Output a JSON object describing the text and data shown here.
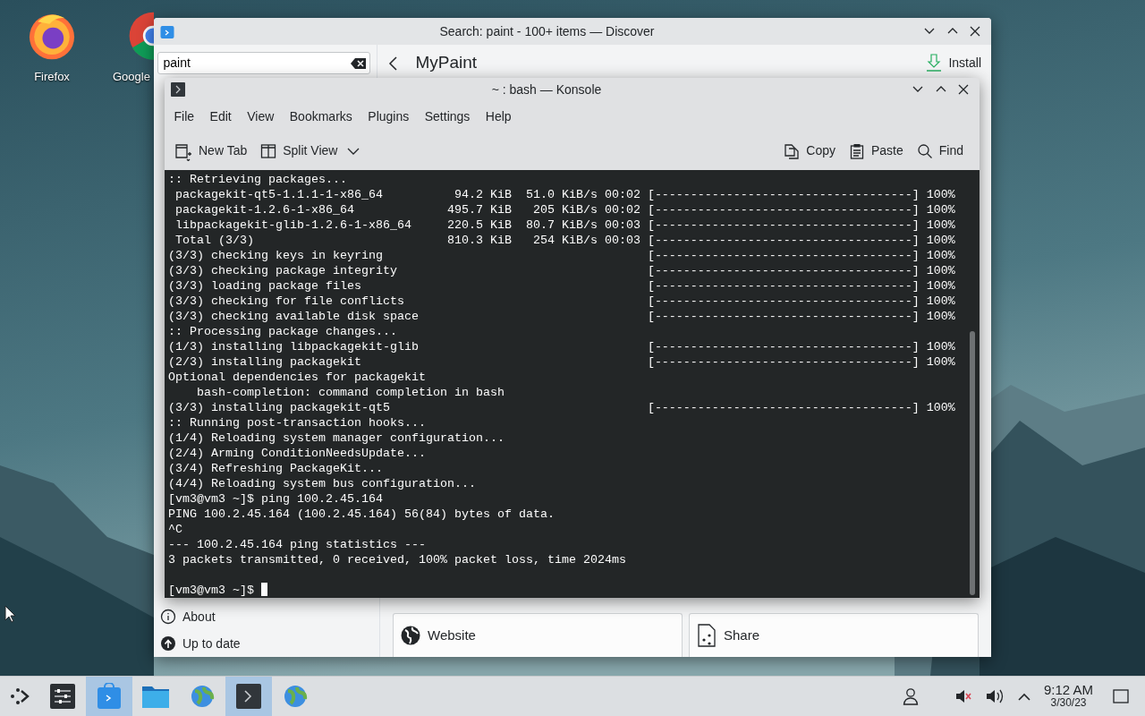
{
  "desktop": {
    "icons": [
      {
        "kind": "firefox",
        "label": "Firefox"
      },
      {
        "kind": "chrome",
        "label": "Google"
      }
    ]
  },
  "discover": {
    "title": "Search: paint - 100+ items — Discover",
    "search": {
      "value": "paint"
    },
    "page_title": "MyPaint",
    "install": "Install",
    "sidebar": [
      {
        "kind": "about",
        "label": "About"
      },
      {
        "kind": "updates",
        "label": "Up to date"
      }
    ],
    "links": [
      {
        "kind": "website",
        "label": "Website"
      },
      {
        "kind": "share",
        "label": "Share"
      }
    ]
  },
  "konsole": {
    "title": "~ : bash — Konsole",
    "menu": [
      "File",
      "Edit",
      "View",
      "Bookmarks",
      "Plugins",
      "Settings",
      "Help"
    ],
    "toolbar_left": [
      {
        "kind": "new-tab",
        "label": "New Tab"
      },
      {
        "kind": "split",
        "label": "Split View"
      }
    ],
    "toolbar_right": [
      {
        "kind": "copy",
        "label": "Copy"
      },
      {
        "kind": "paste",
        "label": "Paste"
      },
      {
        "kind": "find",
        "label": "Find"
      }
    ],
    "lines": [
      {
        "kind": "text",
        "text": ":: Retrieving packages..."
      },
      {
        "kind": "text",
        "text": " packagekit-qt5-1.1.1-1-x86_64          94.2 KiB  51.0 KiB/s 00:02 [------------------------------------] 100%"
      },
      {
        "kind": "text",
        "text": " packagekit-1.2.6-1-x86_64             495.7 KiB   205 KiB/s 00:02 [------------------------------------] 100%"
      },
      {
        "kind": "text",
        "text": " libpackagekit-glib-1.2.6-1-x86_64     220.5 KiB  80.7 KiB/s 00:03 [------------------------------------] 100%"
      },
      {
        "kind": "text",
        "text": " Total (3/3)                           810.3 KiB   254 KiB/s 00:03 [------------------------------------] 100%"
      },
      {
        "kind": "text",
        "text": "(3/3) checking keys in keyring                                     [------------------------------------] 100%"
      },
      {
        "kind": "text",
        "text": "(3/3) checking package integrity                                   [------------------------------------] 100%"
      },
      {
        "kind": "text",
        "text": "(3/3) loading package files                                        [------------------------------------] 100%"
      },
      {
        "kind": "text",
        "text": "(3/3) checking for file conflicts                                  [------------------------------------] 100%"
      },
      {
        "kind": "text",
        "text": "(3/3) checking available disk space                                [------------------------------------] 100%"
      },
      {
        "kind": "text",
        "text": ":: Processing package changes..."
      },
      {
        "kind": "text",
        "text": "(1/3) installing libpackagekit-glib                                [------------------------------------] 100%"
      },
      {
        "kind": "text",
        "text": "(2/3) installing packagekit                                        [------------------------------------] 100%"
      },
      {
        "kind": "text",
        "text": "Optional dependencies for packagekit"
      },
      {
        "kind": "text",
        "text": "    bash-completion: command completion in bash"
      },
      {
        "kind": "text",
        "text": "(3/3) installing packagekit-qt5                                    [------------------------------------] 100%"
      },
      {
        "kind": "text",
        "text": ":: Running post-transaction hooks..."
      },
      {
        "kind": "text",
        "text": "(1/4) Reloading system manager configuration..."
      },
      {
        "kind": "text",
        "text": "(2/4) Arming ConditionNeedsUpdate..."
      },
      {
        "kind": "text",
        "text": "(3/4) Refreshing PackageKit..."
      },
      {
        "kind": "text",
        "text": "(4/4) Reloading system bus configuration..."
      },
      {
        "kind": "text",
        "text": "[vm3@vm3 ~]$ ping 100.2.45.164"
      },
      {
        "kind": "text",
        "text": "PING 100.2.45.164 (100.2.45.164) 56(84) bytes of data."
      },
      {
        "kind": "text",
        "text": "^C"
      },
      {
        "kind": "text",
        "text": "--- 100.2.45.164 ping statistics ---"
      },
      {
        "kind": "text",
        "text": "3 packets transmitted, 0 received, 100% packet loss, time 2024ms"
      },
      {
        "kind": "blank"
      },
      {
        "kind": "prompt",
        "text": "[vm3@vm3 ~]$",
        "cursor": true
      }
    ]
  },
  "taskbar": {
    "items": [
      {
        "kind": "launcher",
        "highlighted": false
      },
      {
        "kind": "settings",
        "highlighted": false
      },
      {
        "kind": "discover",
        "highlighted": true
      },
      {
        "kind": "folder",
        "highlighted": false
      },
      {
        "kind": "globe",
        "highlighted": false
      },
      {
        "kind": "terminal",
        "highlighted": true
      },
      {
        "kind": "globe",
        "highlighted": false
      }
    ],
    "tray": [
      {
        "kind": "user"
      },
      {
        "kind": "muted"
      },
      {
        "kind": "volume"
      },
      {
        "kind": "expand"
      }
    ],
    "clock": {
      "time": "9:12 AM",
      "date": "3/30/23"
    }
  }
}
